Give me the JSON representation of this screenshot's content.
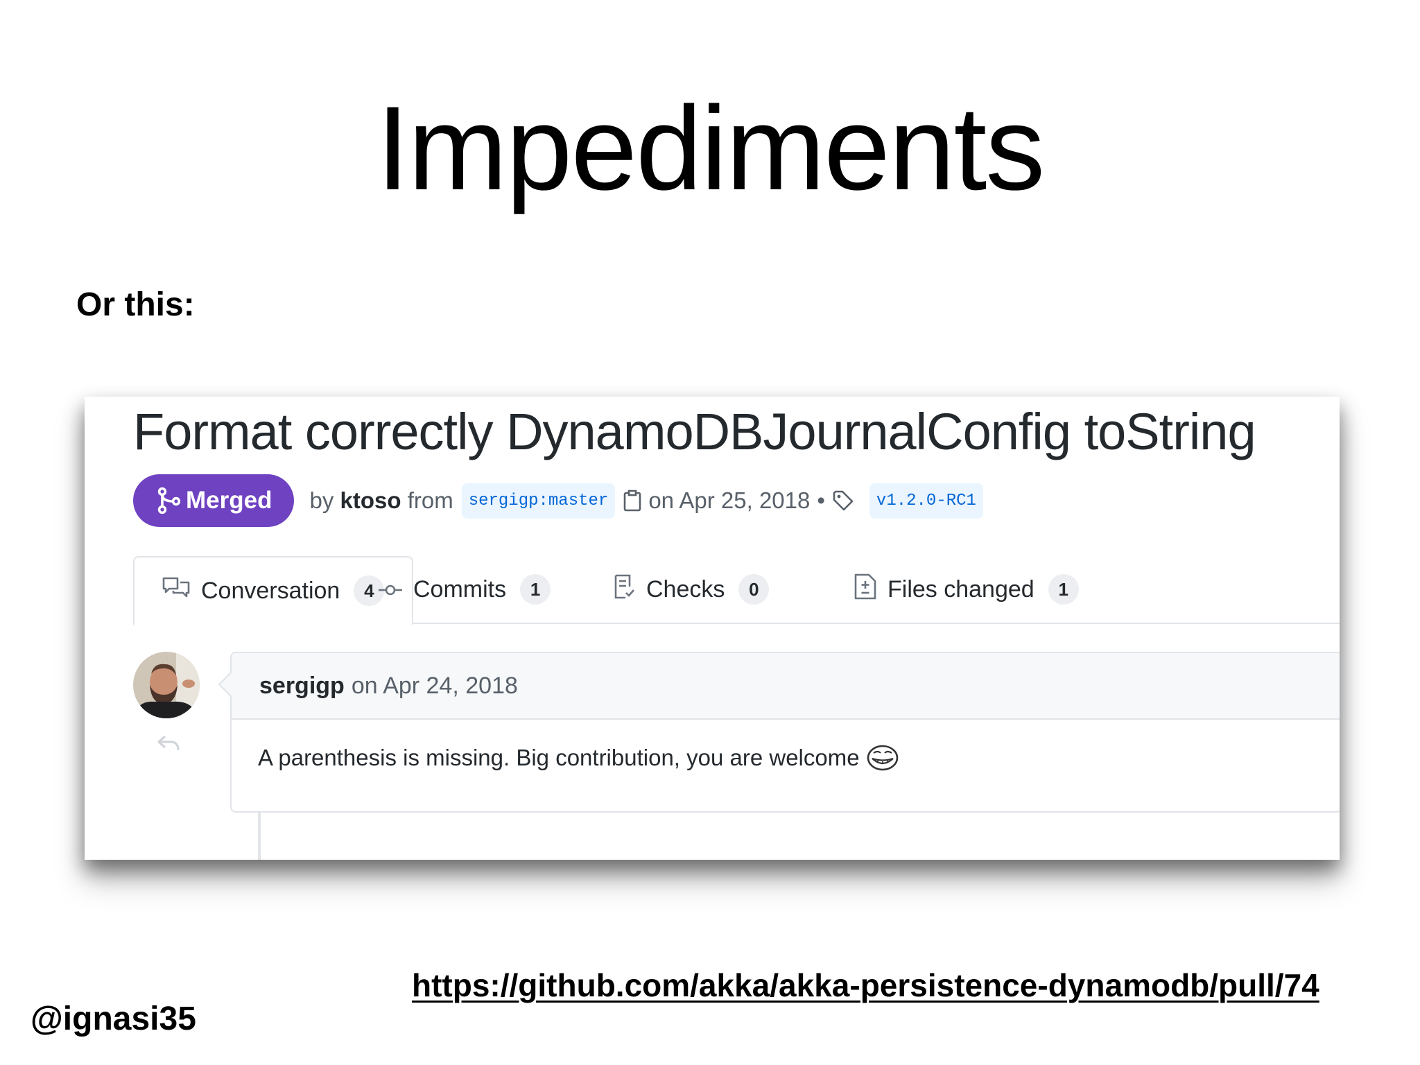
{
  "slide": {
    "title": "Impediments",
    "intro": "Or this:",
    "url": "https://github.com/akka/akka-persistence-dynamodb/pull/74",
    "handle": "@ignasi35"
  },
  "pull_request": {
    "title": "Format correctly DynamoDBJournalConfig toString",
    "status": "Merged",
    "by_prefix": "by",
    "author": "ktoso",
    "from_word": "from",
    "branch": "sergigp:master",
    "date": "on Apr 25, 2018",
    "separator": "•",
    "tag": "v1.2.0-RC1",
    "status_color": "#6f42c1"
  },
  "tabs": [
    {
      "label": "Conversation",
      "count": "4",
      "icon": "comment-discussion-icon"
    },
    {
      "label": "Commits",
      "count": "1",
      "icon": "git-commit-icon"
    },
    {
      "label": "Checks",
      "count": "0",
      "icon": "checklist-icon"
    },
    {
      "label": "Files changed",
      "count": "1",
      "icon": "diff-icon"
    }
  ],
  "comment": {
    "author": "sergigp",
    "date": "on Apr 24, 2018",
    "body": "A parenthesis is missing. Big contribution, you are welcome",
    "emoji": "trollface-emoji"
  }
}
